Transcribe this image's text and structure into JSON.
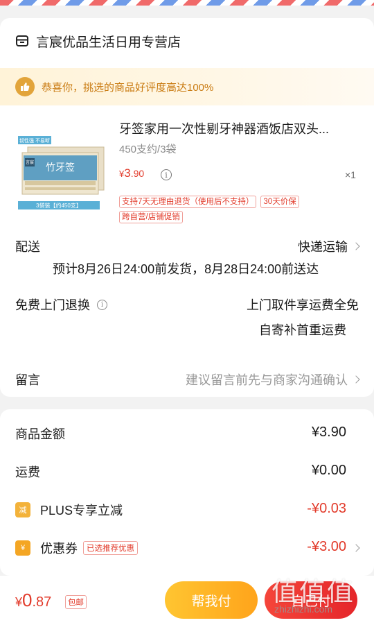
{
  "shop": {
    "name": "言宸优品生活日用专营店",
    "icon": "store-icon"
  },
  "banner": {
    "text": "恭喜你，挑选的商品好评度高达100%",
    "icon": "thumbs-up-icon"
  },
  "product": {
    "title": "牙签家用一次性剔牙神器酒饭店双头...",
    "spec": "450支约/3袋",
    "price_symbol": "¥",
    "price_int": "3",
    "price_dec": ".90",
    "qty": "×1",
    "image_label_top": "韧性强 不易断",
    "image_label_bottom": "3袋装【约450支】",
    "image_brand": "言宸",
    "image_name": "竹牙签",
    "tags": [
      "支持7天无理由退货（使用后不支持）",
      "30天价保",
      "跨自营/店铺促销"
    ]
  },
  "delivery": {
    "label": "配送",
    "method": "快递运输",
    "eta": "预计8月26日24:00前发货，8月28日24:00前送达"
  },
  "returns": {
    "label": "免费上门退换",
    "line1": "上门取件享运费全免",
    "line2": "自寄补首重运费"
  },
  "message": {
    "label": "留言",
    "placeholder": "建议留言前先与商家沟通确认"
  },
  "summary": {
    "goods_label": "商品金额",
    "goods_value": "¥3.90",
    "shipping_label": "运费",
    "shipping_value": "¥0.00",
    "plus_label": "PLUS专享立减",
    "plus_value": "-¥0.03",
    "plus_badge": "减",
    "coupon_label": "优惠券",
    "coupon_tag": "已选推荐优惠",
    "coupon_value": "-¥3.00",
    "coupon_badge": "¥"
  },
  "footer": {
    "total_symbol": "¥",
    "total_int": "0",
    "total_dec": ".87",
    "free_ship": "包邮",
    "help_pay": "帮我付",
    "self_pay": "自己付"
  },
  "watermark": {
    "big": "值值值",
    "small": "zhizhizhi.com"
  },
  "colors": {
    "accent_red": "#e23a2a",
    "help_yellow": "#ffb326",
    "banner_text": "#c97a10"
  }
}
